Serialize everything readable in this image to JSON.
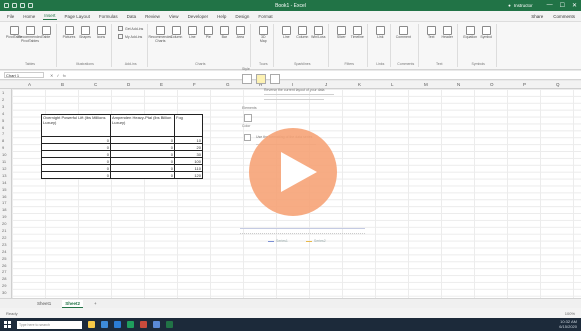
{
  "titlebar": {
    "document_title": "Book1 - Excel",
    "user": "Instructor",
    "minimize": "—",
    "maximize": "☐",
    "close": "✕"
  },
  "menu": {
    "tabs": [
      "File",
      "Home",
      "Insert",
      "Page Layout",
      "Formulas",
      "Data",
      "Review",
      "View",
      "Developer",
      "Help",
      "Design",
      "Format"
    ],
    "active_index": 2,
    "share": "Share",
    "comments": "Comments"
  },
  "ribbon": {
    "groups": [
      {
        "name": "Tables",
        "buttons": [
          "PivotTable",
          "Recommended PivotTables",
          "Table"
        ]
      },
      {
        "name": "Illustrations",
        "buttons": [
          "Pictures",
          "Shapes",
          "Icons"
        ]
      },
      {
        "name": "Add-ins",
        "rows": [
          "Get Add-ins",
          "My Add-ins"
        ]
      },
      {
        "name": "Charts",
        "buttons": [
          "Recommended Charts",
          "Column",
          "Line",
          "Pie",
          "Bar",
          "Area"
        ]
      },
      {
        "name": "Tours",
        "buttons": [
          "3D Map"
        ]
      },
      {
        "name": "Sparklines",
        "buttons": [
          "Line",
          "Column",
          "Win/Loss"
        ]
      },
      {
        "name": "Filters",
        "buttons": [
          "Slicer",
          "Timeline"
        ]
      },
      {
        "name": "Links",
        "buttons": [
          "Link"
        ]
      },
      {
        "name": "Comments",
        "buttons": [
          "Comment"
        ]
      },
      {
        "name": "Text",
        "buttons": [
          "Text",
          "Header"
        ]
      },
      {
        "name": "Symbols",
        "buttons": [
          "Equation",
          "Symbol"
        ]
      }
    ]
  },
  "formula_bar": {
    "name_box": "Chart 1",
    "cancel": "✕",
    "enter": "✓",
    "fx": "fx"
  },
  "columns": [
    "A",
    "B",
    "C",
    "D",
    "E",
    "F",
    "G",
    "H",
    "I",
    "J",
    "K",
    "L",
    "M",
    "N",
    "O",
    "P",
    "Q",
    "R"
  ],
  "rows": [
    "1",
    "2",
    "3",
    "4",
    "5",
    "6",
    "7",
    "8",
    "9",
    "10",
    "11",
    "12",
    "13",
    "14",
    "15",
    "16",
    "17",
    "18",
    "19",
    "20",
    "21",
    "22",
    "23",
    "24",
    "25",
    "26",
    "27",
    "28",
    "29",
    "30"
  ],
  "table": {
    "headers": [
      "Overnight Powerful Lift (lbs Millions Luxury)",
      "Ampenden Heavy-Ptal (lbs Billion Luxury)",
      "Fog"
    ],
    "rows": [
      [
        "0",
        "0",
        "10"
      ],
      [
        "0",
        "0",
        "20"
      ],
      [
        "0",
        "0",
        "30"
      ],
      [
        "0",
        "0",
        "100"
      ],
      [
        "0",
        "0",
        "110"
      ],
      [
        "0",
        "0",
        "120"
      ]
    ]
  },
  "chart": {
    "legend": [
      "Series1",
      "Series2"
    ]
  },
  "quick_tools": {
    "styles_label": "Style",
    "elements_label": "Elements",
    "filter_label": "Filter",
    "color_label": "Color",
    "option1": "Reverse the current layout of your data",
    "option2": "Use the formatting of the data series"
  },
  "play_label": "Play video",
  "sheets": {
    "tabs": [
      "Sheet1",
      "Sheet2"
    ],
    "active_index": 1,
    "add": "+"
  },
  "status": {
    "ready": "Ready",
    "zoom": "100%"
  },
  "taskbar": {
    "search_placeholder": "Type here to search",
    "time": "10:32 AM",
    "date": "6/15/2020",
    "app_colors": [
      "#f7c948",
      "#3e8bd8",
      "#2b7cd3",
      "#1f9e5d",
      "#c94b3c",
      "#5a8ad6",
      "#217346"
    ]
  }
}
